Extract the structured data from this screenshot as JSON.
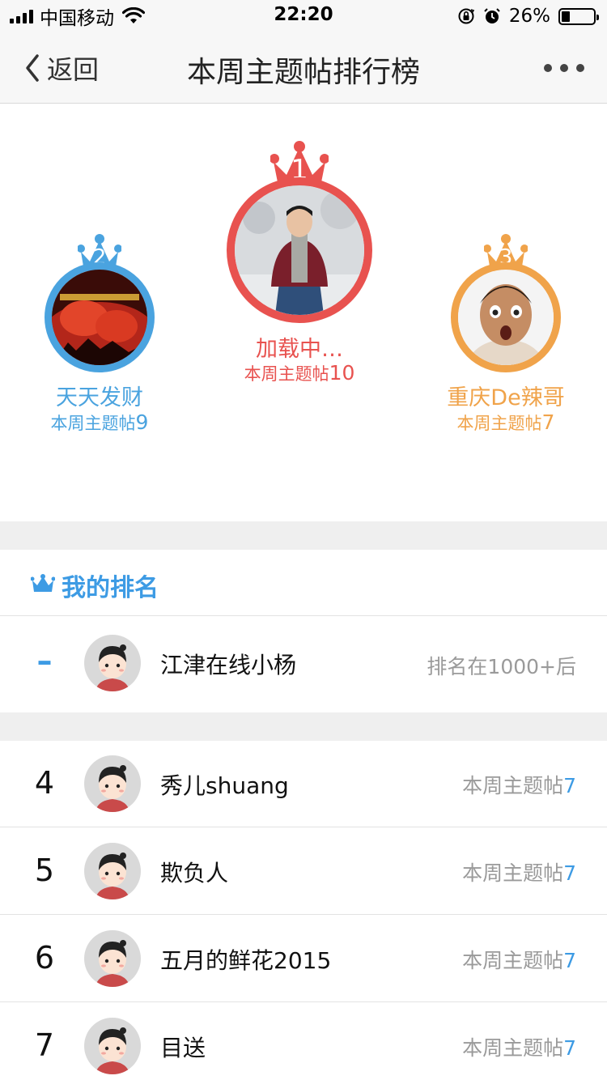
{
  "status_bar": {
    "carrier": "中国移动",
    "time": "22:20",
    "battery_percent": "26%",
    "battery_level": 0.26,
    "icons": [
      "signal-icon",
      "wifi-icon",
      "orientation-lock-icon",
      "alarm-icon",
      "battery-icon"
    ]
  },
  "nav": {
    "back_label": "返回",
    "title": "本周主题帖排行榜",
    "more_icon": "more-icon"
  },
  "podium": {
    "first": {
      "rank": "1",
      "name": "加载中…",
      "label": "本周主题帖",
      "count": "10",
      "color": "#e8524f"
    },
    "second": {
      "rank": "2",
      "name": "天天发财",
      "label": "本周主题帖",
      "count": "9",
      "color": "#4aa3df"
    },
    "third": {
      "rank": "3",
      "name": "重庆De辣哥",
      "label": "本周主题帖",
      "count": "7",
      "color": "#f0a34a"
    }
  },
  "my_rank": {
    "title": "我的排名",
    "rank": "–",
    "name": "江津在线小杨",
    "status": "排名在1000+后"
  },
  "list": [
    {
      "rank": "4",
      "name": "秀儿shuang",
      "label": "本周主题帖",
      "count": "7"
    },
    {
      "rank": "5",
      "name": "欺负人",
      "label": "本周主题帖",
      "count": "7"
    },
    {
      "rank": "6",
      "name": "五月的鲜花2015",
      "label": "本周主题帖",
      "count": "7"
    },
    {
      "rank": "7",
      "name": "目送",
      "label": "本周主题帖",
      "count": "7"
    }
  ],
  "colors": {
    "accent": "#3d9be4",
    "muted": "#9a9a9a",
    "band": "#efefef"
  }
}
